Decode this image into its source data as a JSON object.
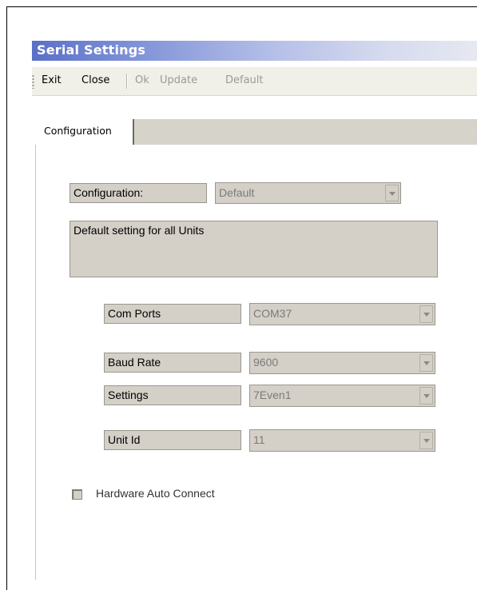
{
  "window": {
    "title": "Serial Settings"
  },
  "toolbar": {
    "exit_label": "Exit",
    "close_label": "Close",
    "ok_label": "Ok",
    "update_label": "Update",
    "default_label": "Default"
  },
  "tabs": [
    {
      "label": "Configuration"
    }
  ],
  "form": {
    "configuration_label": "Configuration:",
    "configuration_value": "Default",
    "description": "Default setting for all Units",
    "com_ports_label": "Com Ports",
    "com_ports_value": "COM37",
    "baud_rate_label": "Baud Rate",
    "baud_rate_value": "9600",
    "settings_label": "Settings",
    "settings_value": "7Even1",
    "unit_id_label": "Unit Id",
    "unit_id_value": "11",
    "hardware_auto_connect_label": "Hardware Auto Connect",
    "hardware_auto_connect_checked": false
  },
  "colors": {
    "title_gradient_start": "#5a70c8",
    "disabled_text": "#9a9a9a",
    "control_face": "#d4d0c8"
  }
}
